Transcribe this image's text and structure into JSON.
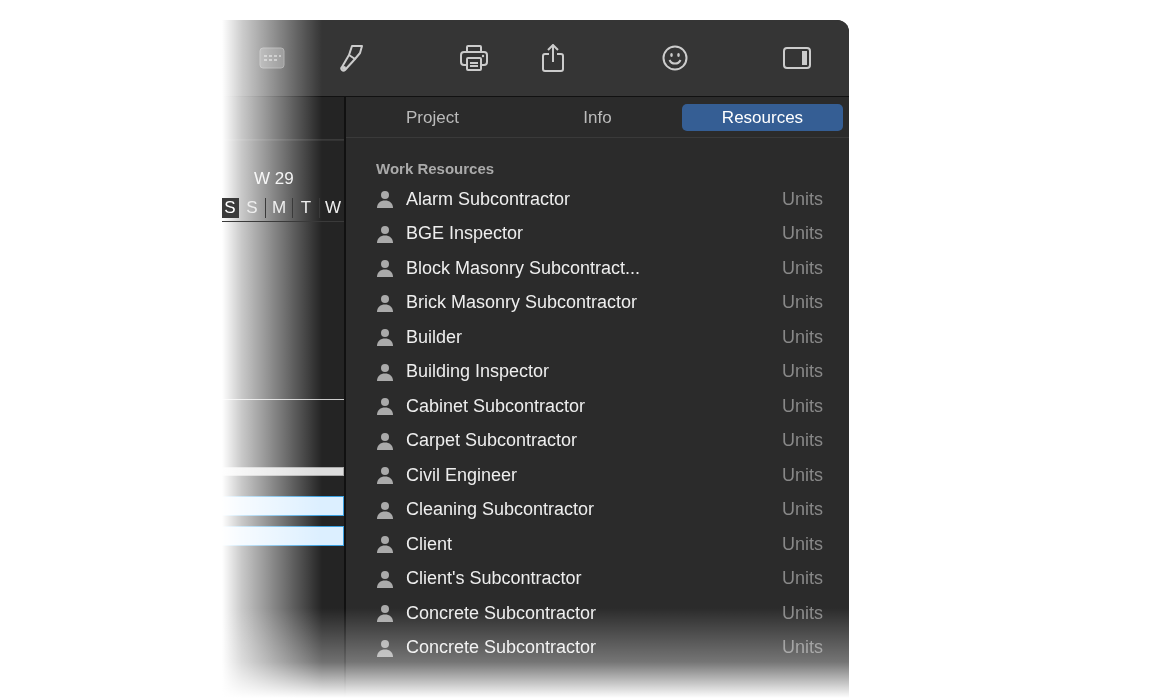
{
  "tabs": [
    {
      "label": "Project",
      "selected": false
    },
    {
      "label": "Info",
      "selected": false
    },
    {
      "label": "Resources",
      "selected": true
    }
  ],
  "timeline": {
    "week": "W 29",
    "days": [
      "S",
      "S",
      "M",
      "T",
      "W"
    ]
  },
  "gantt_bars": [
    {
      "kind": "summary"
    },
    {
      "kind": "task"
    },
    {
      "kind": "task"
    }
  ],
  "resources": {
    "heading": "Work Resources",
    "items": [
      {
        "name": "Alarm Subcontractor",
        "unit": "Units"
      },
      {
        "name": "BGE Inspector",
        "unit": "Units"
      },
      {
        "name": "Block Masonry Subcontract...",
        "unit": "Units"
      },
      {
        "name": "Brick Masonry Subcontractor",
        "unit": "Units"
      },
      {
        "name": "Builder",
        "unit": "Units"
      },
      {
        "name": "Building Inspector",
        "unit": "Units"
      },
      {
        "name": "Cabinet Subcontractor",
        "unit": "Units"
      },
      {
        "name": "Carpet Subcontractor",
        "unit": "Units"
      },
      {
        "name": "Civil Engineer",
        "unit": "Units"
      },
      {
        "name": "Cleaning Subcontractor",
        "unit": "Units"
      },
      {
        "name": "Client",
        "unit": "Units"
      },
      {
        "name": "Client's Subcontractor",
        "unit": "Units"
      },
      {
        "name": "Concrete Subcontractor",
        "unit": "Units"
      },
      {
        "name": "Concrete Subcontractor",
        "unit": "Units"
      }
    ]
  }
}
